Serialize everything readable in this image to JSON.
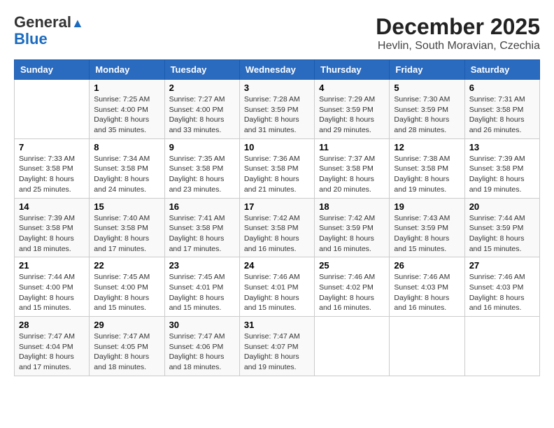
{
  "header": {
    "logo_line1": "General",
    "logo_line2": "Blue",
    "month": "December 2025",
    "location": "Hevlin, South Moravian, Czechia"
  },
  "weekdays": [
    "Sunday",
    "Monday",
    "Tuesday",
    "Wednesday",
    "Thursday",
    "Friday",
    "Saturday"
  ],
  "weeks": [
    [
      {
        "day": "",
        "sunrise": "",
        "sunset": "",
        "daylight": ""
      },
      {
        "day": "1",
        "sunrise": "7:25 AM",
        "sunset": "4:00 PM",
        "daylight": "8 hours and 35 minutes."
      },
      {
        "day": "2",
        "sunrise": "7:27 AM",
        "sunset": "4:00 PM",
        "daylight": "8 hours and 33 minutes."
      },
      {
        "day": "3",
        "sunrise": "7:28 AM",
        "sunset": "3:59 PM",
        "daylight": "8 hours and 31 minutes."
      },
      {
        "day": "4",
        "sunrise": "7:29 AM",
        "sunset": "3:59 PM",
        "daylight": "8 hours and 29 minutes."
      },
      {
        "day": "5",
        "sunrise": "7:30 AM",
        "sunset": "3:59 PM",
        "daylight": "8 hours and 28 minutes."
      },
      {
        "day": "6",
        "sunrise": "7:31 AM",
        "sunset": "3:58 PM",
        "daylight": "8 hours and 26 minutes."
      }
    ],
    [
      {
        "day": "7",
        "sunrise": "7:33 AM",
        "sunset": "3:58 PM",
        "daylight": "8 hours and 25 minutes."
      },
      {
        "day": "8",
        "sunrise": "7:34 AM",
        "sunset": "3:58 PM",
        "daylight": "8 hours and 24 minutes."
      },
      {
        "day": "9",
        "sunrise": "7:35 AM",
        "sunset": "3:58 PM",
        "daylight": "8 hours and 23 minutes."
      },
      {
        "day": "10",
        "sunrise": "7:36 AM",
        "sunset": "3:58 PM",
        "daylight": "8 hours and 21 minutes."
      },
      {
        "day": "11",
        "sunrise": "7:37 AM",
        "sunset": "3:58 PM",
        "daylight": "8 hours and 20 minutes."
      },
      {
        "day": "12",
        "sunrise": "7:38 AM",
        "sunset": "3:58 PM",
        "daylight": "8 hours and 19 minutes."
      },
      {
        "day": "13",
        "sunrise": "7:39 AM",
        "sunset": "3:58 PM",
        "daylight": "8 hours and 19 minutes."
      }
    ],
    [
      {
        "day": "14",
        "sunrise": "7:39 AM",
        "sunset": "3:58 PM",
        "daylight": "8 hours and 18 minutes."
      },
      {
        "day": "15",
        "sunrise": "7:40 AM",
        "sunset": "3:58 PM",
        "daylight": "8 hours and 17 minutes."
      },
      {
        "day": "16",
        "sunrise": "7:41 AM",
        "sunset": "3:58 PM",
        "daylight": "8 hours and 17 minutes."
      },
      {
        "day": "17",
        "sunrise": "7:42 AM",
        "sunset": "3:58 PM",
        "daylight": "8 hours and 16 minutes."
      },
      {
        "day": "18",
        "sunrise": "7:42 AM",
        "sunset": "3:59 PM",
        "daylight": "8 hours and 16 minutes."
      },
      {
        "day": "19",
        "sunrise": "7:43 AM",
        "sunset": "3:59 PM",
        "daylight": "8 hours and 15 minutes."
      },
      {
        "day": "20",
        "sunrise": "7:44 AM",
        "sunset": "3:59 PM",
        "daylight": "8 hours and 15 minutes."
      }
    ],
    [
      {
        "day": "21",
        "sunrise": "7:44 AM",
        "sunset": "4:00 PM",
        "daylight": "8 hours and 15 minutes."
      },
      {
        "day": "22",
        "sunrise": "7:45 AM",
        "sunset": "4:00 PM",
        "daylight": "8 hours and 15 minutes."
      },
      {
        "day": "23",
        "sunrise": "7:45 AM",
        "sunset": "4:01 PM",
        "daylight": "8 hours and 15 minutes."
      },
      {
        "day": "24",
        "sunrise": "7:46 AM",
        "sunset": "4:01 PM",
        "daylight": "8 hours and 15 minutes."
      },
      {
        "day": "25",
        "sunrise": "7:46 AM",
        "sunset": "4:02 PM",
        "daylight": "8 hours and 16 minutes."
      },
      {
        "day": "26",
        "sunrise": "7:46 AM",
        "sunset": "4:03 PM",
        "daylight": "8 hours and 16 minutes."
      },
      {
        "day": "27",
        "sunrise": "7:46 AM",
        "sunset": "4:03 PM",
        "daylight": "8 hours and 16 minutes."
      }
    ],
    [
      {
        "day": "28",
        "sunrise": "7:47 AM",
        "sunset": "4:04 PM",
        "daylight": "8 hours and 17 minutes."
      },
      {
        "day": "29",
        "sunrise": "7:47 AM",
        "sunset": "4:05 PM",
        "daylight": "8 hours and 18 minutes."
      },
      {
        "day": "30",
        "sunrise": "7:47 AM",
        "sunset": "4:06 PM",
        "daylight": "8 hours and 18 minutes."
      },
      {
        "day": "31",
        "sunrise": "7:47 AM",
        "sunset": "4:07 PM",
        "daylight": "8 hours and 19 minutes."
      },
      {
        "day": "",
        "sunrise": "",
        "sunset": "",
        "daylight": ""
      },
      {
        "day": "",
        "sunrise": "",
        "sunset": "",
        "daylight": ""
      },
      {
        "day": "",
        "sunrise": "",
        "sunset": "",
        "daylight": ""
      }
    ]
  ]
}
